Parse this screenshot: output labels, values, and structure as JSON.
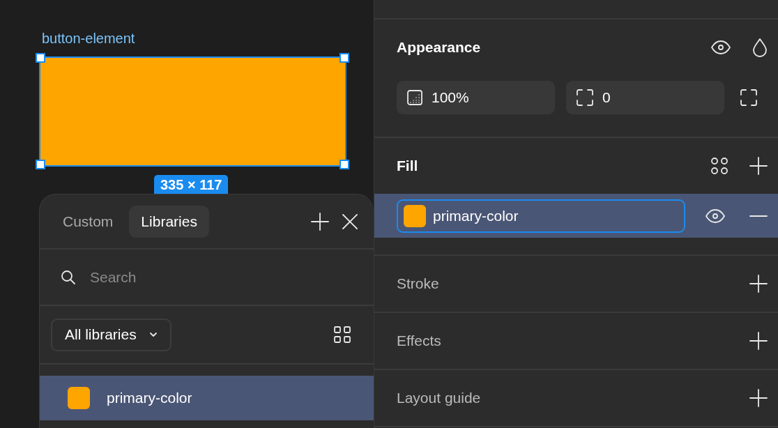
{
  "canvas": {
    "frame": {
      "name": "button-element",
      "color": "#ffa500",
      "selected": true,
      "size": "335 × 117"
    }
  },
  "color_picker": {
    "tabs": [
      {
        "label": "Custom",
        "selected": false
      },
      {
        "label": "Libraries",
        "selected": true
      }
    ],
    "search": {
      "placeholder": "Search"
    },
    "library_filter": {
      "value": "All libraries"
    },
    "styles": [
      {
        "name": "primary-color",
        "color": "#ffa500",
        "selected": true
      }
    ]
  },
  "properties": {
    "appearance": {
      "title": "Appearance",
      "opacity": "100%",
      "corner_radius": "0"
    },
    "fill": {
      "title": "Fill",
      "items": [
        {
          "name": "primary-color",
          "color": "#ffa500",
          "selected": true
        }
      ]
    },
    "sections": [
      {
        "title": "Stroke"
      },
      {
        "title": "Effects"
      },
      {
        "title": "Layout guide"
      }
    ]
  }
}
